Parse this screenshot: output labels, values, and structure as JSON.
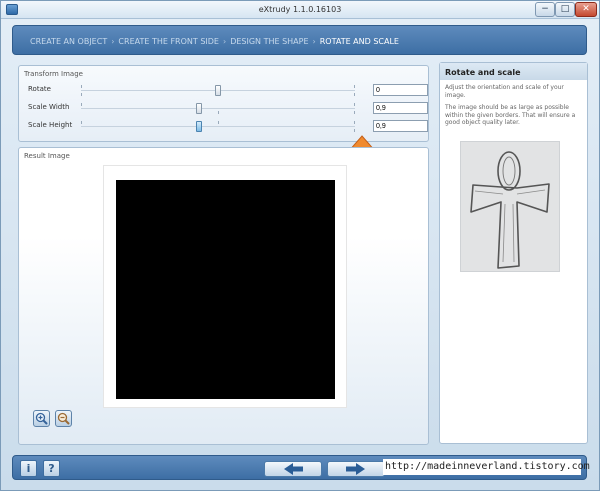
{
  "window": {
    "title": "eXtrudy 1.1.0.16103",
    "minimize_label": "−",
    "maximize_label": "□",
    "close_label": "✕"
  },
  "wizard": {
    "separator": "›",
    "steps": [
      {
        "label": "CREATE AN OBJECT"
      },
      {
        "label": "CREATE THE FRONT SIDE"
      },
      {
        "label": "DESIGN THE SHAPE"
      },
      {
        "label": "ROTATE AND SCALE"
      }
    ],
    "active_step": 3
  },
  "transform": {
    "title": "Transform Image",
    "rows": [
      {
        "label": "Rotate",
        "value": "0",
        "slider_fraction": 0.5
      },
      {
        "label": "Scale Width",
        "value": "0,9",
        "slider_fraction": 0.43
      },
      {
        "label": "Scale Height",
        "value": "0,9",
        "slider_fraction": 0.43
      }
    ]
  },
  "result": {
    "title": "Result Image"
  },
  "help": {
    "title": "Rotate and scale",
    "paragraph1": "Adjust the orientation and scale of your image.",
    "paragraph2": "The image should be as large as possible within the given borders. That will ensure a good object quality later."
  },
  "footer": {
    "info_label": "i",
    "help_label": "?"
  },
  "watermark": "http://madeinneverland.tistory.com",
  "colors": {
    "accent": "#3d6ea4",
    "highlight_arrow": "#f08a2e",
    "canvas": "#000000"
  }
}
